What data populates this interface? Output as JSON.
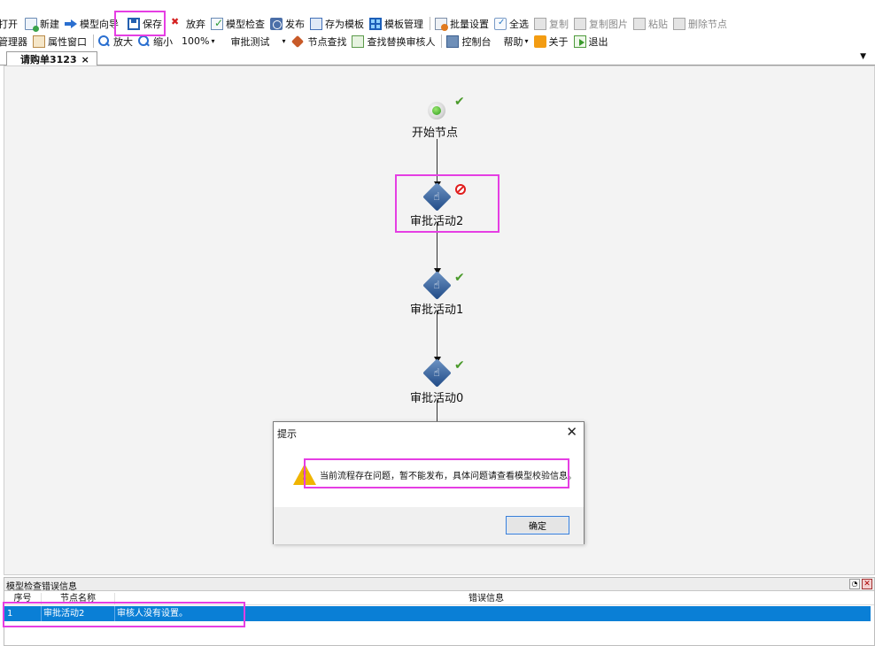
{
  "toolbar1": [
    {
      "label": "打开",
      "icon": "open-icon",
      "disabled": false
    },
    {
      "label": "新建",
      "icon": "new-icon",
      "disabled": false
    },
    {
      "label": "模型向导",
      "icon": "wizard-arrow-icon",
      "disabled": false
    },
    {
      "label": "保存",
      "icon": "save-icon",
      "disabled": false
    },
    {
      "label": "放弃",
      "icon": "discard-icon",
      "disabled": false
    },
    {
      "label": "模型检查",
      "icon": "model-check-icon",
      "disabled": false
    },
    {
      "label": "发布",
      "icon": "publish-icon",
      "disabled": false
    },
    {
      "label": "存为模板",
      "icon": "save-template-icon",
      "disabled": false
    },
    {
      "label": "模板管理",
      "icon": "template-manage-icon",
      "disabled": false
    },
    {
      "label": "批量设置",
      "icon": "batch-settings-icon",
      "disabled": false
    },
    {
      "label": "全选",
      "icon": "select-all-icon",
      "disabled": false
    },
    {
      "label": "复制",
      "icon": "copy-icon",
      "disabled": true
    },
    {
      "label": "复制图片",
      "icon": "copy-image-icon",
      "disabled": true
    },
    {
      "label": "粘贴",
      "icon": "paste-icon",
      "disabled": true
    },
    {
      "label": "删除节点",
      "icon": "delete-node-icon",
      "disabled": true
    }
  ],
  "toolbar2": {
    "manager": "管理器",
    "property_window": "属性窗口",
    "zoom_in": "放大",
    "zoom_out": "缩小",
    "zoom_level": "100%",
    "approval_test": "审批测试",
    "node_find": "节点查找",
    "find_replace_reviewer": "查找替换审核人",
    "console": "控制台",
    "help": "帮助",
    "about": "关于",
    "exit": "退出"
  },
  "tab": {
    "label": "请购单3123",
    "close": "×",
    "menu_glyph": "▼"
  },
  "flow": {
    "nodes": [
      {
        "label": "开始节点",
        "status": "ok"
      },
      {
        "label": "审批活动2",
        "status": "error"
      },
      {
        "label": "审批活动1",
        "status": "ok"
      },
      {
        "label": "审批活动0",
        "status": "ok"
      }
    ]
  },
  "dialog": {
    "title": "提示",
    "close": "✕",
    "message": "当前流程存在问题，暂不能发布，具体问题请查看模型校验信息。",
    "ok_label": "确定"
  },
  "error_panel": {
    "title": "模型检查错误信息",
    "columns": [
      "序号",
      "节点名称",
      "错误信息"
    ],
    "rows": [
      {
        "index": "1",
        "node": "审批活动2",
        "message": "审核人没有设置。"
      }
    ]
  },
  "colors": {
    "highlight": "#e53ee3",
    "selected_row": "#0a7fd6",
    "ok": "#4a9a2a",
    "error": "#e01c1c"
  }
}
